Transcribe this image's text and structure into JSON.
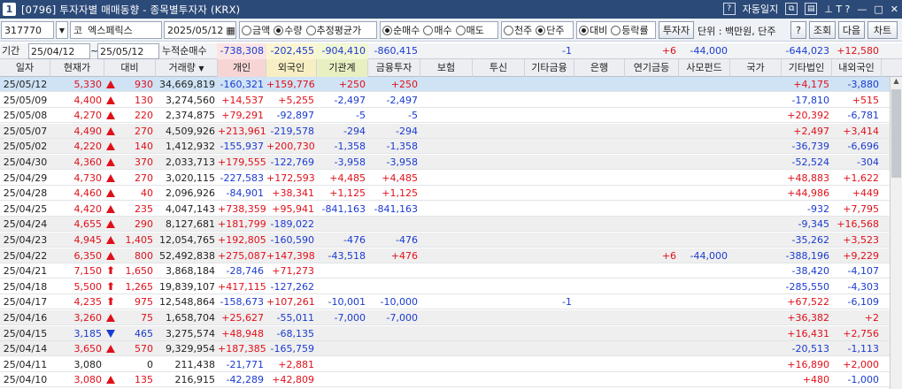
{
  "window": {
    "number": "1",
    "title": "[0796] 투자자별 매매동향 - 종목별투자자 (KRX)",
    "auto_log_label": "자동일지",
    "question": "?",
    "help_icons": "⊥ T ?"
  },
  "toolbar": {
    "code": "317770",
    "market_prefix": "코",
    "stock_name": "엑스페릭스",
    "date": "2025/05/12",
    "unit_radios": [
      {
        "label": "금액",
        "on": false
      },
      {
        "label": "수량",
        "on": true
      },
      {
        "label": "추정평균가",
        "on": false
      }
    ],
    "trade_radios": [
      {
        "label": "순매수",
        "on": true
      },
      {
        "label": "매수",
        "on": false
      },
      {
        "label": "매도",
        "on": false
      }
    ],
    "unit2_radios": [
      {
        "label": "천주",
        "on": false
      },
      {
        "label": "단주",
        "on": true
      }
    ],
    "compare_radios": [
      {
        "label": "대비",
        "on": true
      },
      {
        "label": "등락률",
        "on": false
      }
    ],
    "investor_button": "투자자",
    "unit_text": "단위 : 백만원, 단주",
    "help_button": "?",
    "search_button": "조회",
    "next_button": "다음",
    "chart_button": "차트"
  },
  "period": {
    "label": "기간",
    "from": "25/04/12",
    "tilde": "~",
    "to": "25/05/12",
    "accum_label": "누적순매수"
  },
  "summary": {
    "individual": "-738,308",
    "foreign": "-202,455",
    "institution": "-904,410",
    "finance": "-860,415",
    "insurance": "",
    "trust": "",
    "other_fin": "-1",
    "bank": "",
    "pension": "+6",
    "private_fund": "-44,000",
    "nation": "",
    "other_corp": "-644,023",
    "domestic_foreign": "+12,580"
  },
  "columns": [
    "일자",
    "현재가",
    "대비",
    "거래량",
    "개인",
    "외국인",
    "기관계",
    "금융투자",
    "보험",
    "투신",
    "기타금융",
    "은행",
    "연기금등",
    "사모펀드",
    "국가",
    "기타법인",
    "내외국인"
  ],
  "sort_marker": "▼",
  "rows": [
    {
      "date": "25/05/12",
      "price": "5,330",
      "dir": "up",
      "chg": "930",
      "vol": "34,669,819",
      "ind": "-160,321",
      "for": "+159,776",
      "inst": "+250",
      "fin": "+250",
      "oth": "",
      "pen": "",
      "pf": "",
      "corp": "+4,175",
      "dom": "-3,880",
      "sel": true
    },
    {
      "date": "25/05/09",
      "price": "4,400",
      "dir": "up",
      "chg": "130",
      "vol": "3,274,560",
      "ind": "+14,537",
      "for": "+5,255",
      "inst": "-2,497",
      "fin": "-2,497",
      "oth": "",
      "pen": "",
      "pf": "",
      "corp": "-17,810",
      "dom": "+515"
    },
    {
      "date": "25/05/08",
      "price": "4,270",
      "dir": "up",
      "chg": "220",
      "vol": "2,374,875",
      "ind": "+79,291",
      "for": "-92,897",
      "inst": "-5",
      "fin": "-5",
      "oth": "",
      "pen": "",
      "pf": "",
      "corp": "+20,392",
      "dom": "-6,781"
    },
    {
      "date": "25/05/07",
      "price": "4,490",
      "dir": "up",
      "chg": "270",
      "vol": "4,509,926",
      "ind": "+213,961",
      "for": "-219,578",
      "inst": "-294",
      "fin": "-294",
      "oth": "",
      "pen": "",
      "pf": "",
      "corp": "+2,497",
      "dom": "+3,414",
      "shade": true
    },
    {
      "date": "25/05/02",
      "price": "4,220",
      "dir": "up",
      "chg": "140",
      "vol": "1,412,932",
      "ind": "-155,937",
      "for": "+200,730",
      "inst": "-1,358",
      "fin": "-1,358",
      "oth": "",
      "pen": "",
      "pf": "",
      "corp": "-36,739",
      "dom": "-6,696",
      "shade": true
    },
    {
      "date": "25/04/30",
      "price": "4,360",
      "dir": "up",
      "chg": "370",
      "vol": "2,033,713",
      "ind": "+179,555",
      "for": "-122,769",
      "inst": "-3,958",
      "fin": "-3,958",
      "oth": "",
      "pen": "",
      "pf": "",
      "corp": "-52,524",
      "dom": "-304",
      "shade": true
    },
    {
      "date": "25/04/29",
      "price": "4,730",
      "dir": "up",
      "chg": "270",
      "vol": "3,020,115",
      "ind": "-227,583",
      "for": "+172,593",
      "inst": "+4,485",
      "fin": "+4,485",
      "oth": "",
      "pen": "",
      "pf": "",
      "corp": "+48,883",
      "dom": "+1,622"
    },
    {
      "date": "25/04/28",
      "price": "4,460",
      "dir": "up",
      "chg": "40",
      "vol": "2,096,926",
      "ind": "-84,901",
      "for": "+38,341",
      "inst": "+1,125",
      "fin": "+1,125",
      "oth": "",
      "pen": "",
      "pf": "",
      "corp": "+44,986",
      "dom": "+449"
    },
    {
      "date": "25/04/25",
      "price": "4,420",
      "dir": "up",
      "chg": "235",
      "vol": "4,047,143",
      "ind": "+738,359",
      "for": "+95,941",
      "inst": "-841,163",
      "fin": "-841,163",
      "oth": "",
      "pen": "",
      "pf": "",
      "corp": "-932",
      "dom": "+7,795"
    },
    {
      "date": "25/04/24",
      "price": "4,655",
      "dir": "up",
      "chg": "290",
      "vol": "8,127,681",
      "ind": "+181,799",
      "for": "-189,022",
      "inst": "",
      "fin": "",
      "oth": "",
      "pen": "",
      "pf": "",
      "corp": "-9,345",
      "dom": "+16,568",
      "shade": true
    },
    {
      "date": "25/04/23",
      "price": "4,945",
      "dir": "up",
      "chg": "1,405",
      "vol": "12,054,765",
      "ind": "+192,805",
      "for": "-160,590",
      "inst": "-476",
      "fin": "-476",
      "oth": "",
      "pen": "",
      "pf": "",
      "corp": "-35,262",
      "dom": "+3,523",
      "shade": true
    },
    {
      "date": "25/04/22",
      "price": "6,350",
      "dir": "up",
      "chg": "800",
      "vol": "52,492,838",
      "ind": "+275,087",
      "for": "+147,398",
      "inst": "-43,518",
      "fin": "+476",
      "oth": "",
      "pen": "+6",
      "pf": "-44,000",
      "corp": "-388,196",
      "dom": "+9,229",
      "shade": true
    },
    {
      "date": "25/04/21",
      "price": "7,150",
      "dir": "upper",
      "chg": "1,650",
      "vol": "3,868,184",
      "ind": "-28,746",
      "for": "+71,273",
      "inst": "",
      "fin": "",
      "oth": "",
      "pen": "",
      "pf": "",
      "corp": "-38,420",
      "dom": "-4,107"
    },
    {
      "date": "25/04/18",
      "price": "5,500",
      "dir": "upper",
      "chg": "1,265",
      "vol": "19,839,107",
      "ind": "+417,115",
      "for": "-127,262",
      "inst": "",
      "fin": "",
      "oth": "",
      "pen": "",
      "pf": "",
      "corp": "-285,550",
      "dom": "-4,303"
    },
    {
      "date": "25/04/17",
      "price": "4,235",
      "dir": "upper",
      "chg": "975",
      "vol": "12,548,864",
      "ind": "-158,673",
      "for": "+107,261",
      "inst": "-10,001",
      "fin": "-10,000",
      "oth": "-1",
      "pen": "",
      "pf": "",
      "corp": "+67,522",
      "dom": "-6,109"
    },
    {
      "date": "25/04/16",
      "price": "3,260",
      "dir": "up",
      "chg": "75",
      "vol": "1,658,704",
      "ind": "+25,627",
      "for": "-55,011",
      "inst": "-7,000",
      "fin": "-7,000",
      "oth": "",
      "pen": "",
      "pf": "",
      "corp": "+36,382",
      "dom": "+2",
      "shade": true
    },
    {
      "date": "25/04/15",
      "price": "3,185",
      "dir": "dn",
      "chg": "465",
      "vol": "3,275,574",
      "ind": "+48,948",
      "for": "-68,135",
      "inst": "",
      "fin": "",
      "oth": "",
      "pen": "",
      "pf": "",
      "corp": "+16,431",
      "dom": "+2,756",
      "shade": true
    },
    {
      "date": "25/04/14",
      "price": "3,650",
      "dir": "up",
      "chg": "570",
      "vol": "9,329,954",
      "ind": "+187,385",
      "for": "-165,759",
      "inst": "",
      "fin": "",
      "oth": "",
      "pen": "",
      "pf": "",
      "corp": "-20,513",
      "dom": "-1,113",
      "shade": true
    },
    {
      "date": "25/04/11",
      "price": "3,080",
      "dir": "none",
      "chg": "0",
      "vol": "211,438",
      "ind": "-21,771",
      "for": "+2,881",
      "inst": "",
      "fin": "",
      "oth": "",
      "pen": "",
      "pf": "",
      "corp": "+16,890",
      "dom": "+2,000"
    },
    {
      "date": "25/04/10",
      "price": "3,080",
      "dir": "up",
      "chg": "135",
      "vol": "216,915",
      "ind": "-42,289",
      "for": "+42,809",
      "inst": "",
      "fin": "",
      "oth": "",
      "pen": "",
      "pf": "",
      "corp": "+480",
      "dom": "-1,000"
    }
  ],
  "colors": {
    "up": "#e0101a",
    "down": "#1a3bd0",
    "title_bg": "#2c4a78",
    "selected_row": "#cfe3f5"
  }
}
